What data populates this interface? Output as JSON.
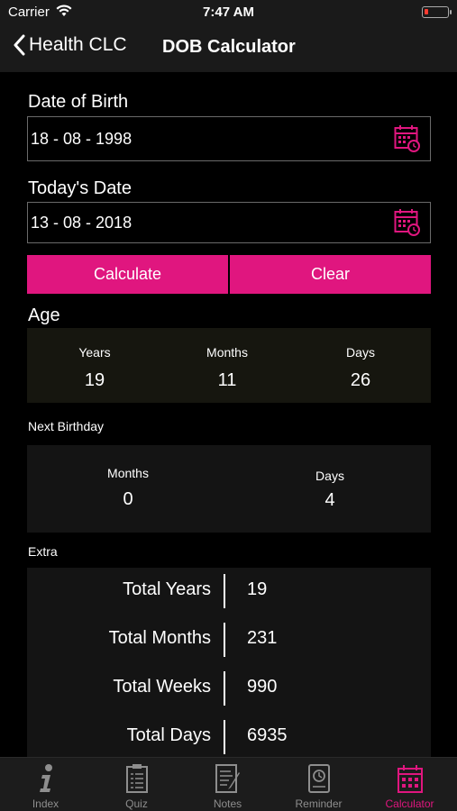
{
  "status_bar": {
    "carrier": "Carrier",
    "time": "7:47 AM"
  },
  "nav": {
    "back_label": "Health CLC",
    "title": "DOB Calculator"
  },
  "dob": {
    "label": "Date of Birth",
    "value": "18 - 08 - 1998"
  },
  "today": {
    "label": "Today's Date",
    "value": "13 - 08 - 2018"
  },
  "buttons": {
    "calculate": "Calculate",
    "clear": "Clear"
  },
  "age": {
    "title": "Age",
    "years_label": "Years",
    "years": "19",
    "months_label": "Months",
    "months": "11",
    "days_label": "Days",
    "days": "26"
  },
  "next_birthday": {
    "title": "Next Birthday",
    "months_label": "Months",
    "months": "0",
    "days_label": "Days",
    "days": "4"
  },
  "extra": {
    "title": "Extra",
    "rows": [
      {
        "label": "Total Years",
        "value": "19"
      },
      {
        "label": "Total Months",
        "value": "231"
      },
      {
        "label": "Total Weeks",
        "value": "990"
      },
      {
        "label": "Total Days",
        "value": "6935"
      }
    ]
  },
  "tabs": [
    {
      "label": "Index",
      "icon": "info-icon"
    },
    {
      "label": "Quiz",
      "icon": "clipboard-icon"
    },
    {
      "label": "Notes",
      "icon": "notes-icon"
    },
    {
      "label": "Reminder",
      "icon": "reminder-icon"
    },
    {
      "label": "Calculator",
      "icon": "calculator-calendar-icon",
      "active": true
    }
  ],
  "colors": {
    "accent": "#e0167f",
    "panel_age": "#16160f",
    "panel_dark": "#141414",
    "bar_bg": "#1a1a1a"
  }
}
